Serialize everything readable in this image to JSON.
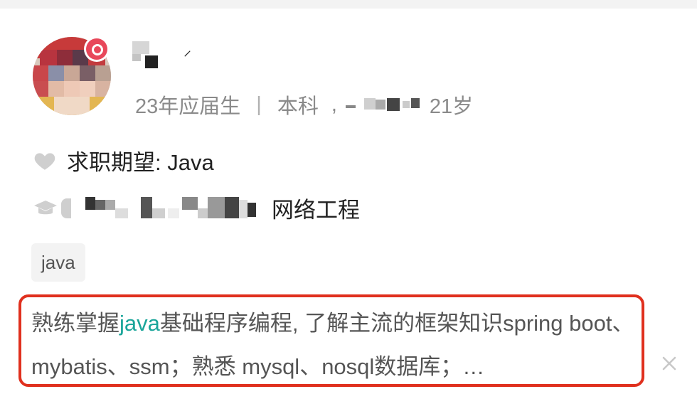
{
  "profile": {
    "name_mark": "⸍",
    "meta": {
      "grad_year": "23年应届生",
      "separator": "|",
      "degree": "本科",
      "comma": ",",
      "age": "21岁"
    },
    "expect_text": "求职期望: Java",
    "edu_major": "网络工程",
    "tag": "java",
    "desc": {
      "part1": "熟练掌握",
      "highlight": "java",
      "part2": "基础程序编程, 了解主流的框架知识spring boot、mybatis、ssm；熟悉 mysql、nosql数据库；…"
    }
  },
  "icons": {
    "heart": "heart-icon",
    "cap": "graduation-cap-icon",
    "close": "close-icon",
    "badge": "badge-icon"
  },
  "colors": {
    "highlight_text": "#1aa59a",
    "box_border": "#e0301e",
    "badge": "#e8475a",
    "meta_text": "#8a8a8a"
  }
}
